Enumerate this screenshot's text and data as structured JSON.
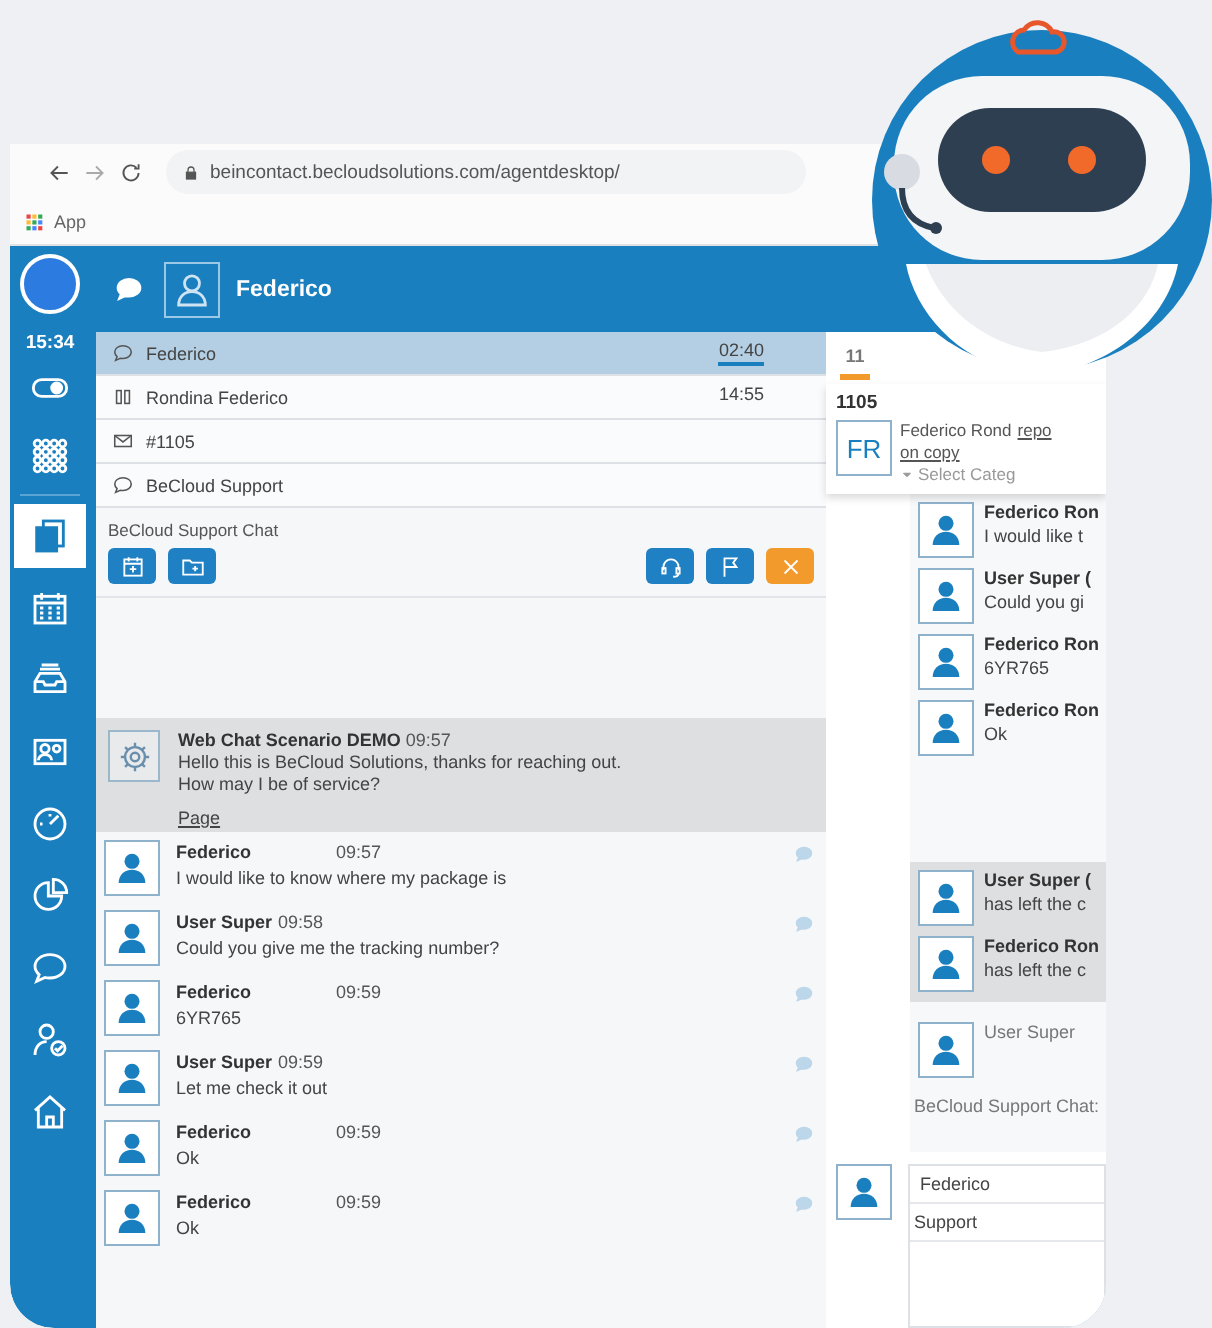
{
  "browser": {
    "url": "beincontact.becloudsolutions.com/agentdesktop/",
    "bookmark": "App"
  },
  "rail": {
    "clock": "15:34",
    "items": [
      {
        "kind": "documents",
        "selected": true
      },
      {
        "kind": "calendar",
        "selected": false
      },
      {
        "kind": "inbox",
        "selected": false
      },
      {
        "kind": "contact",
        "selected": false
      },
      {
        "kind": "gauge",
        "selected": false
      },
      {
        "kind": "pie",
        "selected": false
      },
      {
        "kind": "chat",
        "selected": false
      },
      {
        "kind": "user-check",
        "selected": false
      },
      {
        "kind": "home",
        "selected": false
      }
    ]
  },
  "header": {
    "agent_name": "Federico"
  },
  "sessions": [
    {
      "kind": "chat",
      "name": "Federico",
      "time": "02:40",
      "selected": true
    },
    {
      "kind": "call",
      "name": "Rondina Federico",
      "time": "14:55",
      "selected": false
    },
    {
      "kind": "email",
      "name": "#1105",
      "selected": false
    },
    {
      "kind": "chat",
      "name": "BeCloud Support",
      "selected": false
    }
  ],
  "chat": {
    "title": "BeCloud Support Chat",
    "system_message": {
      "sender": "Web Chat Scenario DEMO",
      "time": "09:57",
      "text": "Hello this is BeCloud Solutions, thanks for reaching out.\nHow may I be of service?",
      "link": "Page"
    },
    "messages": [
      {
        "kind": "customer",
        "sender": "Federico",
        "time": "09:57",
        "text": "I would like to know where my package is"
      },
      {
        "kind": "agent",
        "sender": "User Super",
        "time": "09:58",
        "text": "Could you give me the tracking number?"
      },
      {
        "kind": "customer",
        "sender": "Federico",
        "time": "09:59",
        "text": "6YR765"
      },
      {
        "kind": "agent",
        "sender": "User Super",
        "time": "09:59",
        "text": "Let me check it out"
      },
      {
        "kind": "customer",
        "sender": "Federico",
        "time": "09:59",
        "text": "Ok"
      },
      {
        "kind": "customer",
        "sender": "Federico",
        "time": "09:59",
        "text": "Ok"
      }
    ]
  },
  "case_panel": {
    "tab": {
      "label": "11",
      "selected": true
    },
    "case_number": "1105",
    "card": {
      "initials": "FR",
      "name": "Federico Rond",
      "links": [
        "repo",
        "on copy"
      ],
      "category": "Select Categ"
    },
    "history": [
      {
        "kind": "message",
        "sender": "Federico Ron",
        "text": "I would like t"
      },
      {
        "kind": "message",
        "sender": "User Super (",
        "text": "Could you gi"
      },
      {
        "kind": "message",
        "sender": "Federico Ron",
        "text": "6YR765"
      },
      {
        "kind": "message",
        "sender": "Federico Ron",
        "text": "Ok"
      },
      {
        "kind": "event",
        "sender": "User Super (",
        "text": "has left the c"
      },
      {
        "kind": "event",
        "sender": "Federico Ron",
        "text": "has left the c"
      }
    ],
    "participant": "User Super",
    "chat_label": "BeCloud Support Chat:",
    "reply": {
      "to": "Federico",
      "subject": "Support"
    }
  }
}
